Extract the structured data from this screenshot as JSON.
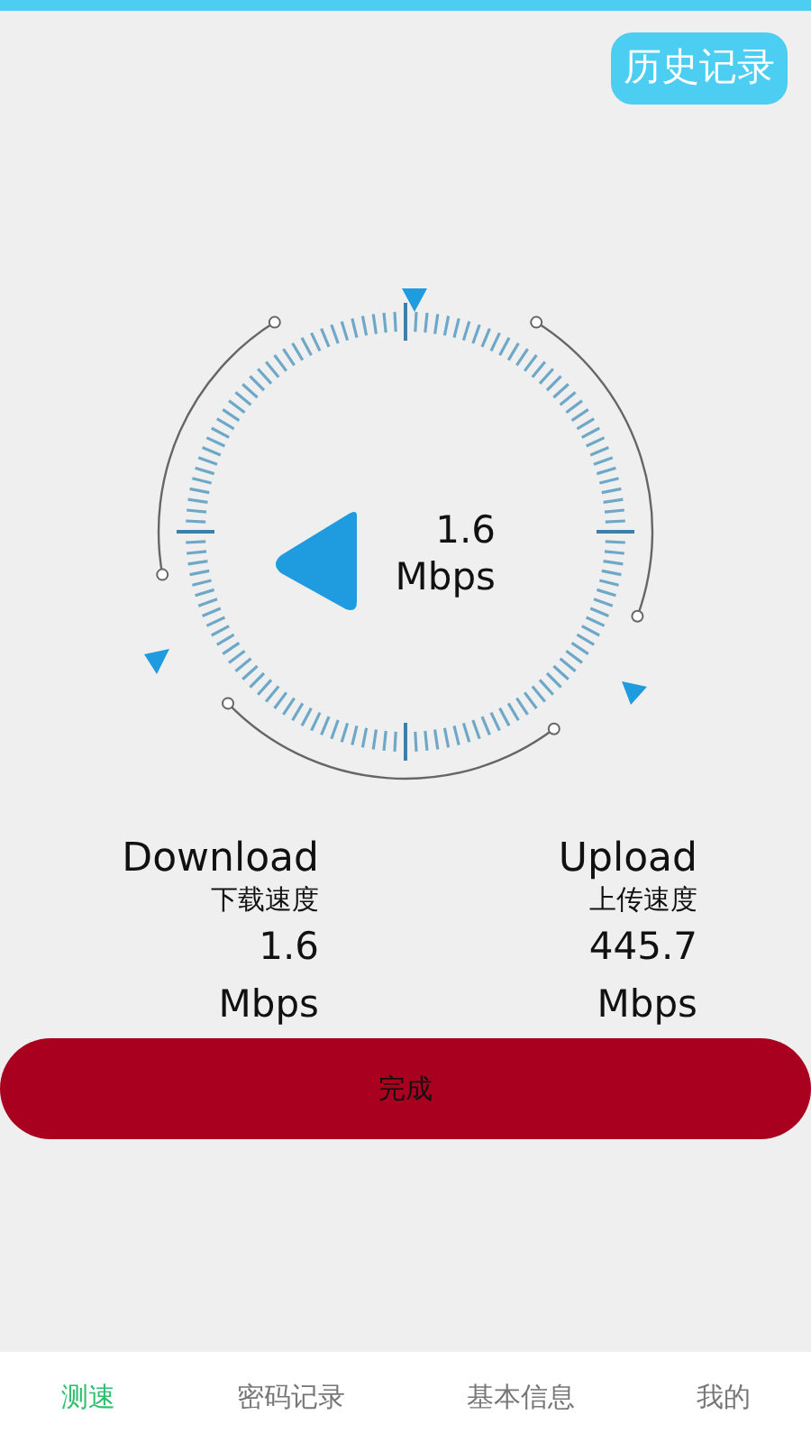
{
  "history_button": "历史记录",
  "gauge": {
    "value": "1.6",
    "unit": "Mbps"
  },
  "stats": [
    {
      "label": "Download",
      "sublabel": "下载速度",
      "value": "1.6",
      "unit": "Mbps"
    },
    {
      "label": "Upload",
      "sublabel": "上传速度",
      "value": "445.7",
      "unit": "Mbps"
    }
  ],
  "done_button": "完成",
  "tabs": [
    {
      "label": "测速",
      "selected": true
    },
    {
      "label": "密码记录",
      "selected": false
    },
    {
      "label": "基本信息",
      "selected": false
    },
    {
      "label": "我的",
      "selected": false
    }
  ]
}
